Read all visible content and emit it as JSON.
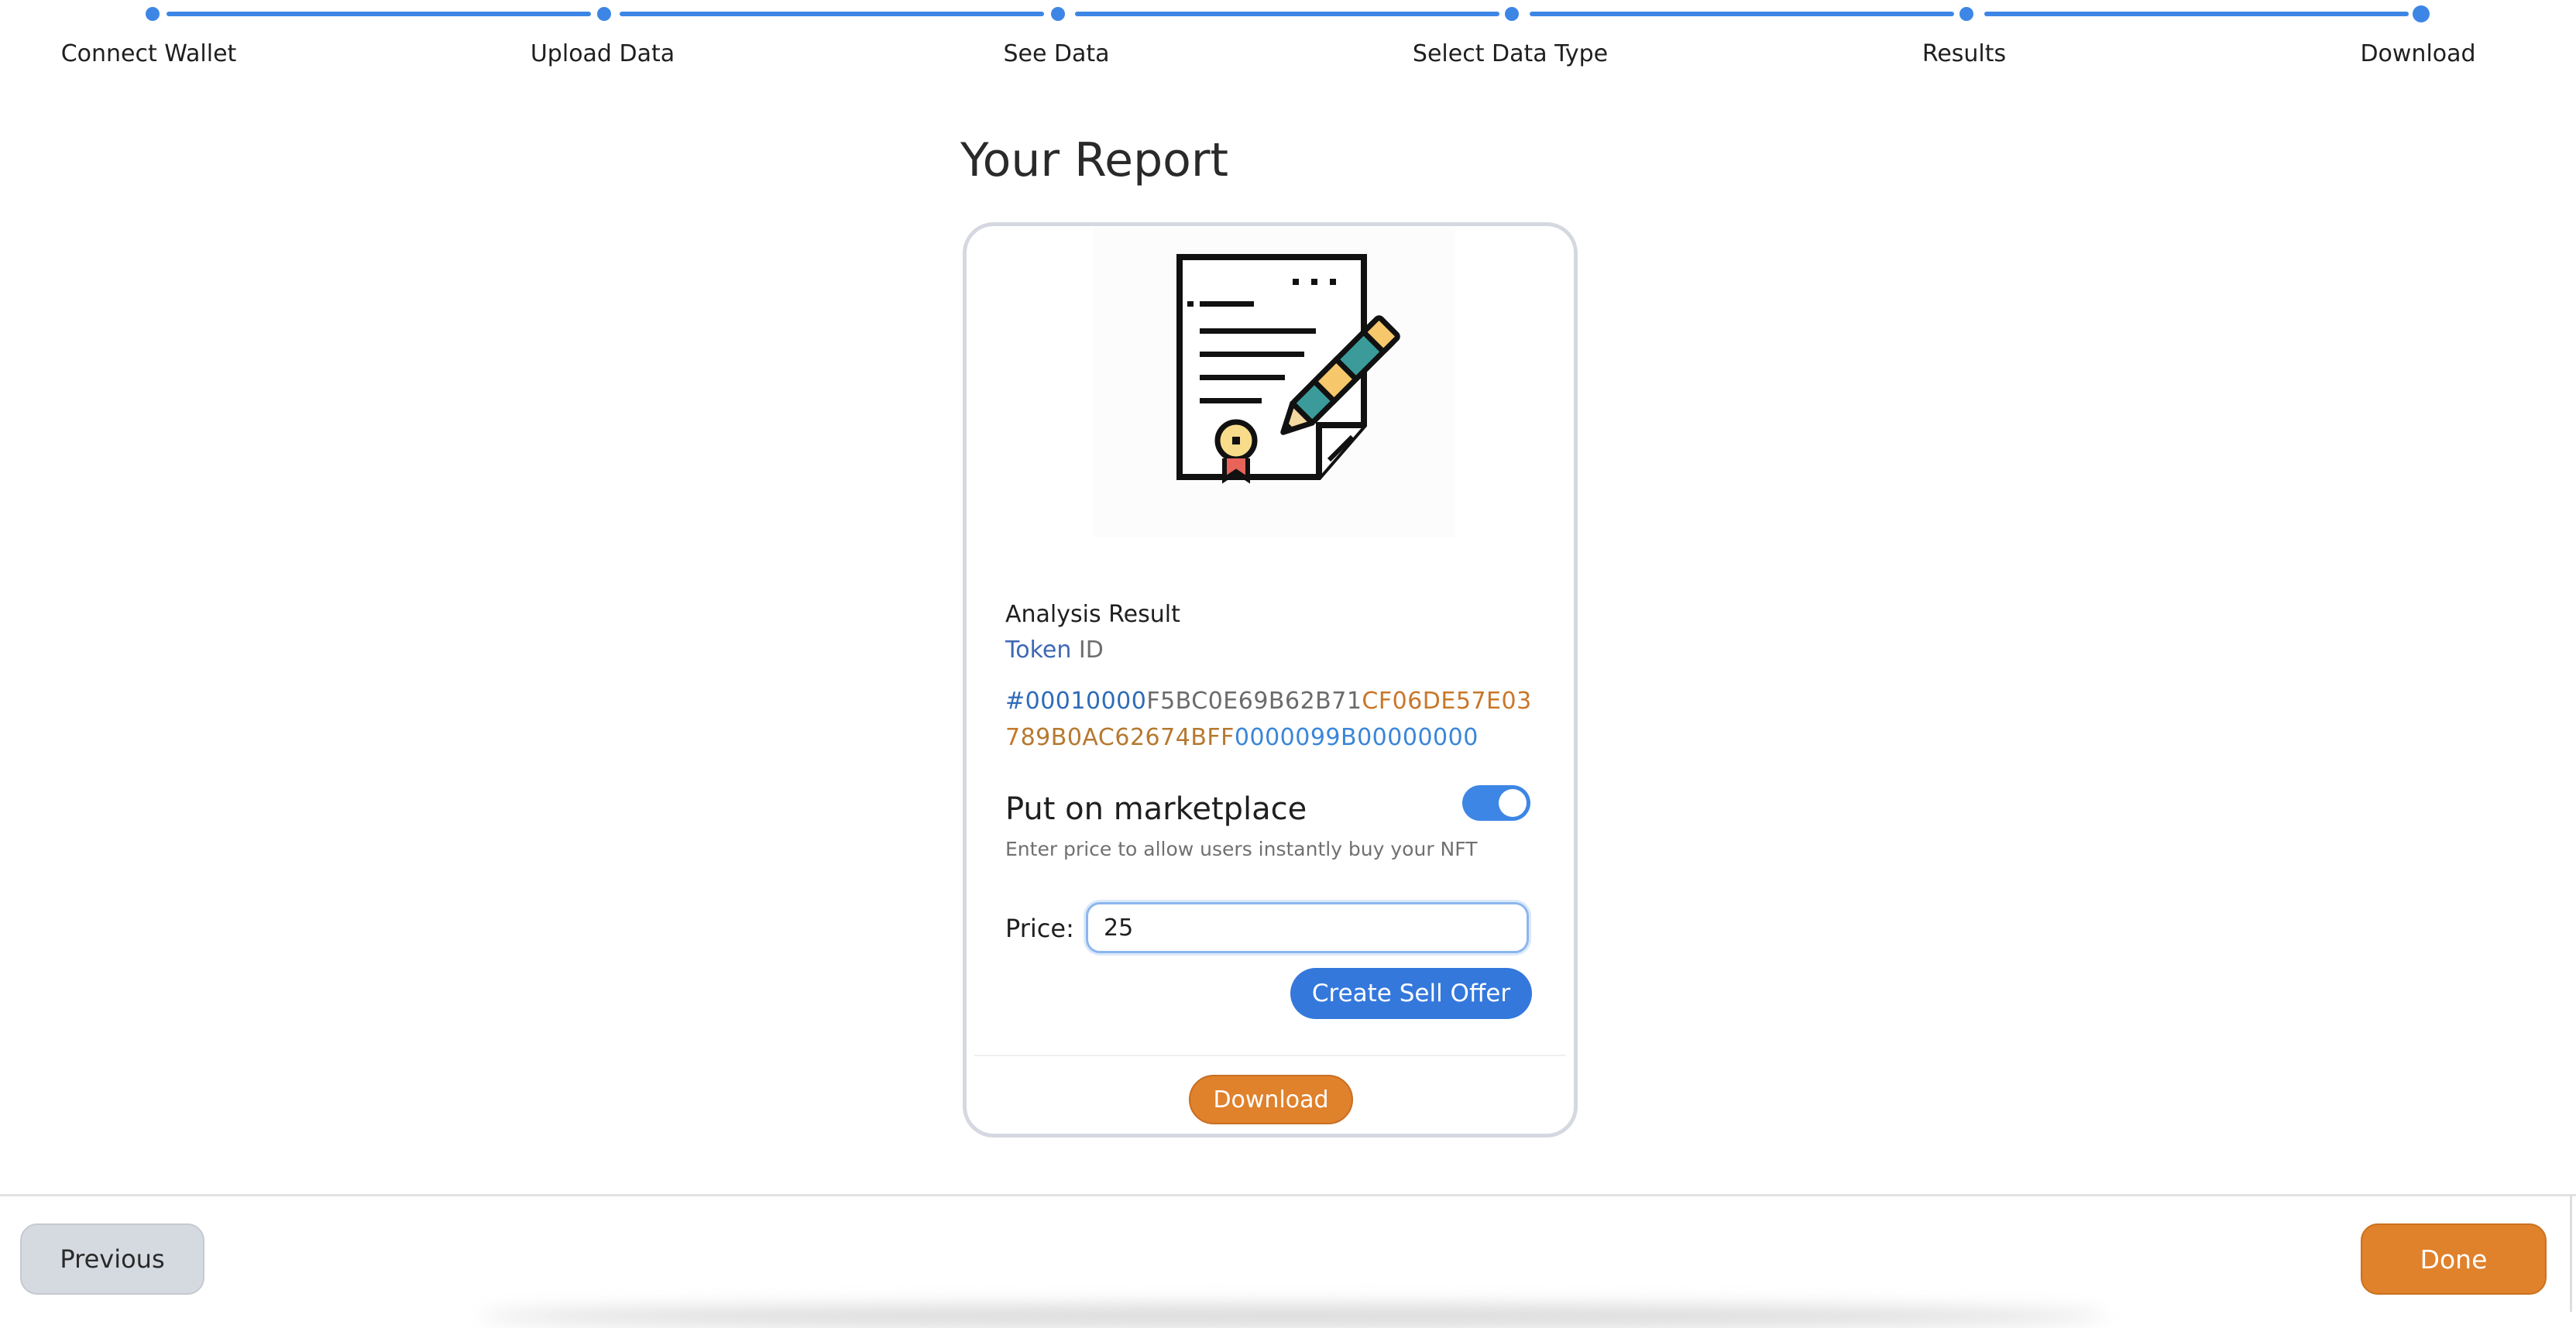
{
  "stepper": {
    "steps": [
      {
        "label": "Connect Wallet"
      },
      {
        "label": "Upload Data"
      },
      {
        "label": "See Data"
      },
      {
        "label": "Select Data Type"
      },
      {
        "label": "Results"
      },
      {
        "label": "Download"
      }
    ],
    "current_step": 6
  },
  "page": {
    "title": "Your Report"
  },
  "card": {
    "image_icon": "certificate-document-with-pen-icon",
    "analysis_title": "Analysis Result",
    "token_label_word1": "Token",
    "token_label_word2": "ID",
    "token_id_parts": [
      "#00010000",
      "F5BC0E69B62B71",
      "CF06DE57E037",
      "89B0AC62674BFF",
      "0000099B00000000"
    ],
    "marketplace": {
      "title": "Put on marketplace",
      "enabled": true,
      "help": "Enter price to allow users instantly buy your NFT"
    },
    "price": {
      "label": "Price:",
      "value": "25"
    },
    "sell_button": "Create Sell Offer",
    "download_button": "Download"
  },
  "footer": {
    "previous_button": "Previous",
    "done_button": "Done"
  },
  "colors": {
    "accent_blue": "#3d86e5",
    "accent_orange": "#e0812c"
  }
}
